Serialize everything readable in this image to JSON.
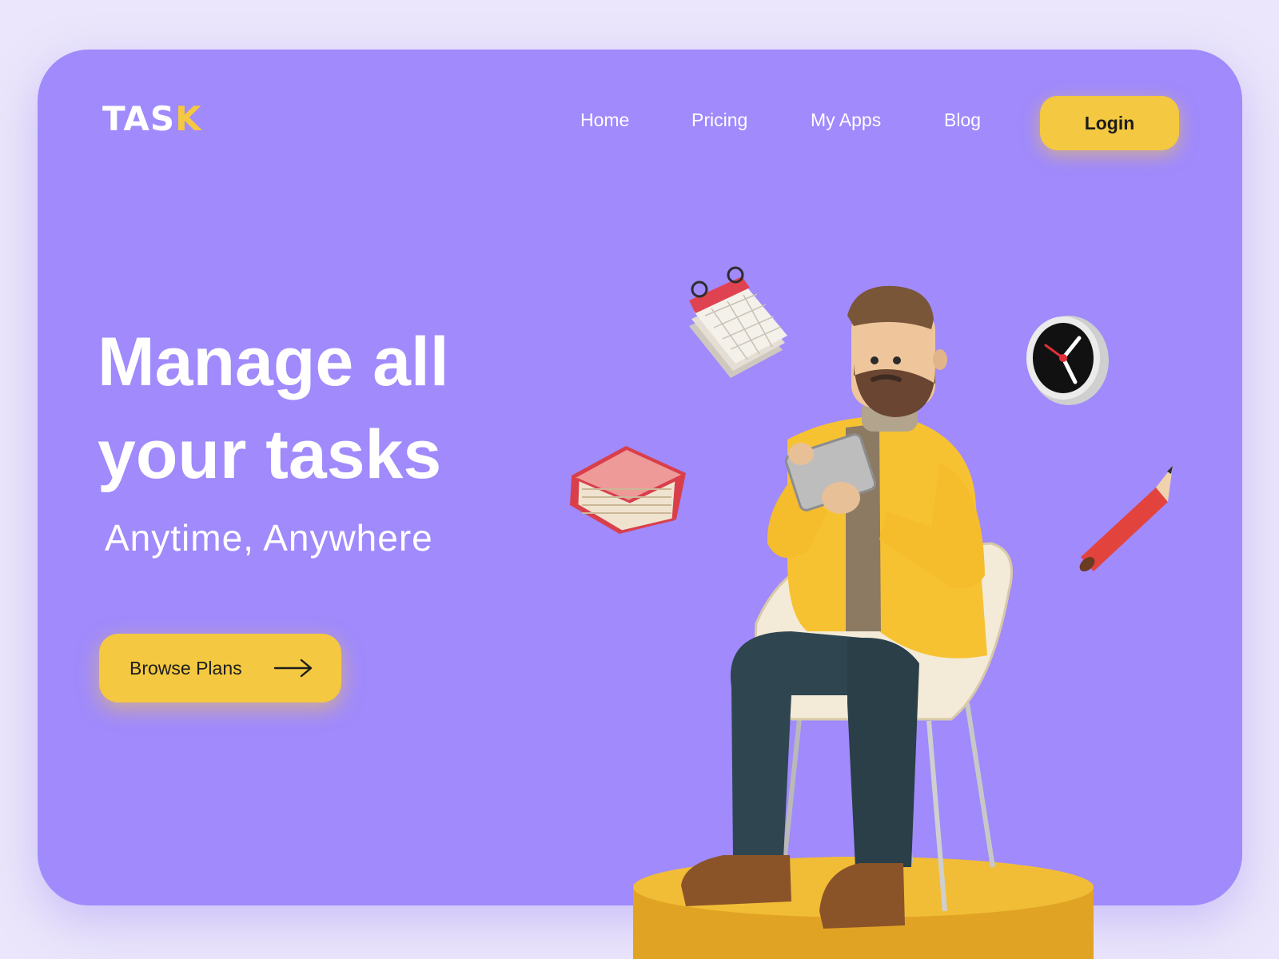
{
  "brand": {
    "logo_main": "TAS",
    "logo_accent": "K"
  },
  "nav": {
    "items": [
      {
        "label": "Home"
      },
      {
        "label": "Pricing"
      },
      {
        "label": "My Apps"
      },
      {
        "label": "Blog"
      }
    ],
    "login_label": "Login"
  },
  "hero": {
    "headline_line1": "Manage all",
    "headline_line2": "your tasks",
    "subheadline": "Anytime, Anywhere",
    "cta_label": "Browse Plans",
    "cta_icon": "arrow-right-icon"
  },
  "illustration": {
    "icons": [
      "calendar-icon",
      "clock-icon",
      "book-icon",
      "pencil-icon",
      "person-on-chair-illustration",
      "podium"
    ]
  },
  "colors": {
    "page_background": "#ebe6fb",
    "card_background": "#a08afc",
    "accent_yellow": "#f4c840",
    "text_white": "#ffffff",
    "button_text": "#1d1d1d"
  }
}
